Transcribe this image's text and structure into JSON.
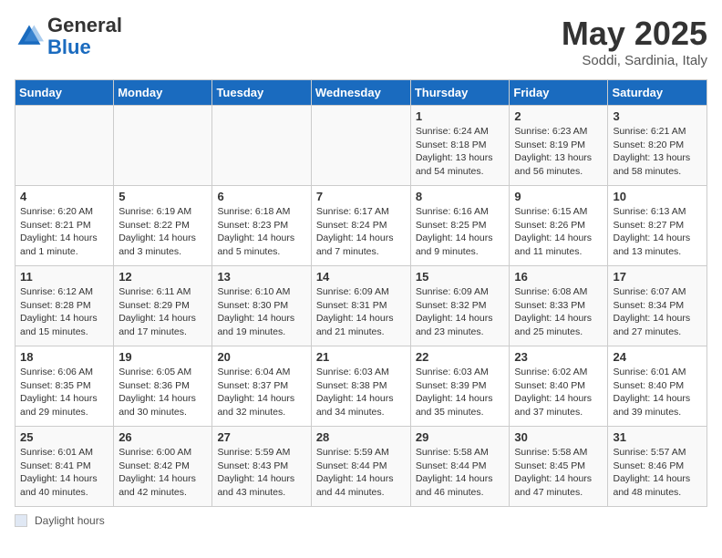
{
  "header": {
    "logo_general": "General",
    "logo_blue": "Blue",
    "month_title": "May 2025",
    "location": "Soddi, Sardinia, Italy"
  },
  "days_of_week": [
    "Sunday",
    "Monday",
    "Tuesday",
    "Wednesday",
    "Thursday",
    "Friday",
    "Saturday"
  ],
  "weeks": [
    [
      {
        "num": "",
        "info": ""
      },
      {
        "num": "",
        "info": ""
      },
      {
        "num": "",
        "info": ""
      },
      {
        "num": "",
        "info": ""
      },
      {
        "num": "1",
        "info": "Sunrise: 6:24 AM\nSunset: 8:18 PM\nDaylight: 13 hours and 54 minutes."
      },
      {
        "num": "2",
        "info": "Sunrise: 6:23 AM\nSunset: 8:19 PM\nDaylight: 13 hours and 56 minutes."
      },
      {
        "num": "3",
        "info": "Sunrise: 6:21 AM\nSunset: 8:20 PM\nDaylight: 13 hours and 58 minutes."
      }
    ],
    [
      {
        "num": "4",
        "info": "Sunrise: 6:20 AM\nSunset: 8:21 PM\nDaylight: 14 hours and 1 minute."
      },
      {
        "num": "5",
        "info": "Sunrise: 6:19 AM\nSunset: 8:22 PM\nDaylight: 14 hours and 3 minutes."
      },
      {
        "num": "6",
        "info": "Sunrise: 6:18 AM\nSunset: 8:23 PM\nDaylight: 14 hours and 5 minutes."
      },
      {
        "num": "7",
        "info": "Sunrise: 6:17 AM\nSunset: 8:24 PM\nDaylight: 14 hours and 7 minutes."
      },
      {
        "num": "8",
        "info": "Sunrise: 6:16 AM\nSunset: 8:25 PM\nDaylight: 14 hours and 9 minutes."
      },
      {
        "num": "9",
        "info": "Sunrise: 6:15 AM\nSunset: 8:26 PM\nDaylight: 14 hours and 11 minutes."
      },
      {
        "num": "10",
        "info": "Sunrise: 6:13 AM\nSunset: 8:27 PM\nDaylight: 14 hours and 13 minutes."
      }
    ],
    [
      {
        "num": "11",
        "info": "Sunrise: 6:12 AM\nSunset: 8:28 PM\nDaylight: 14 hours and 15 minutes."
      },
      {
        "num": "12",
        "info": "Sunrise: 6:11 AM\nSunset: 8:29 PM\nDaylight: 14 hours and 17 minutes."
      },
      {
        "num": "13",
        "info": "Sunrise: 6:10 AM\nSunset: 8:30 PM\nDaylight: 14 hours and 19 minutes."
      },
      {
        "num": "14",
        "info": "Sunrise: 6:09 AM\nSunset: 8:31 PM\nDaylight: 14 hours and 21 minutes."
      },
      {
        "num": "15",
        "info": "Sunrise: 6:09 AM\nSunset: 8:32 PM\nDaylight: 14 hours and 23 minutes."
      },
      {
        "num": "16",
        "info": "Sunrise: 6:08 AM\nSunset: 8:33 PM\nDaylight: 14 hours and 25 minutes."
      },
      {
        "num": "17",
        "info": "Sunrise: 6:07 AM\nSunset: 8:34 PM\nDaylight: 14 hours and 27 minutes."
      }
    ],
    [
      {
        "num": "18",
        "info": "Sunrise: 6:06 AM\nSunset: 8:35 PM\nDaylight: 14 hours and 29 minutes."
      },
      {
        "num": "19",
        "info": "Sunrise: 6:05 AM\nSunset: 8:36 PM\nDaylight: 14 hours and 30 minutes."
      },
      {
        "num": "20",
        "info": "Sunrise: 6:04 AM\nSunset: 8:37 PM\nDaylight: 14 hours and 32 minutes."
      },
      {
        "num": "21",
        "info": "Sunrise: 6:03 AM\nSunset: 8:38 PM\nDaylight: 14 hours and 34 minutes."
      },
      {
        "num": "22",
        "info": "Sunrise: 6:03 AM\nSunset: 8:39 PM\nDaylight: 14 hours and 35 minutes."
      },
      {
        "num": "23",
        "info": "Sunrise: 6:02 AM\nSunset: 8:40 PM\nDaylight: 14 hours and 37 minutes."
      },
      {
        "num": "24",
        "info": "Sunrise: 6:01 AM\nSunset: 8:40 PM\nDaylight: 14 hours and 39 minutes."
      }
    ],
    [
      {
        "num": "25",
        "info": "Sunrise: 6:01 AM\nSunset: 8:41 PM\nDaylight: 14 hours and 40 minutes."
      },
      {
        "num": "26",
        "info": "Sunrise: 6:00 AM\nSunset: 8:42 PM\nDaylight: 14 hours and 42 minutes."
      },
      {
        "num": "27",
        "info": "Sunrise: 5:59 AM\nSunset: 8:43 PM\nDaylight: 14 hours and 43 minutes."
      },
      {
        "num": "28",
        "info": "Sunrise: 5:59 AM\nSunset: 8:44 PM\nDaylight: 14 hours and 44 minutes."
      },
      {
        "num": "29",
        "info": "Sunrise: 5:58 AM\nSunset: 8:44 PM\nDaylight: 14 hours and 46 minutes."
      },
      {
        "num": "30",
        "info": "Sunrise: 5:58 AM\nSunset: 8:45 PM\nDaylight: 14 hours and 47 minutes."
      },
      {
        "num": "31",
        "info": "Sunrise: 5:57 AM\nSunset: 8:46 PM\nDaylight: 14 hours and 48 minutes."
      }
    ]
  ],
  "footer": {
    "box_label": "Daylight hours"
  }
}
